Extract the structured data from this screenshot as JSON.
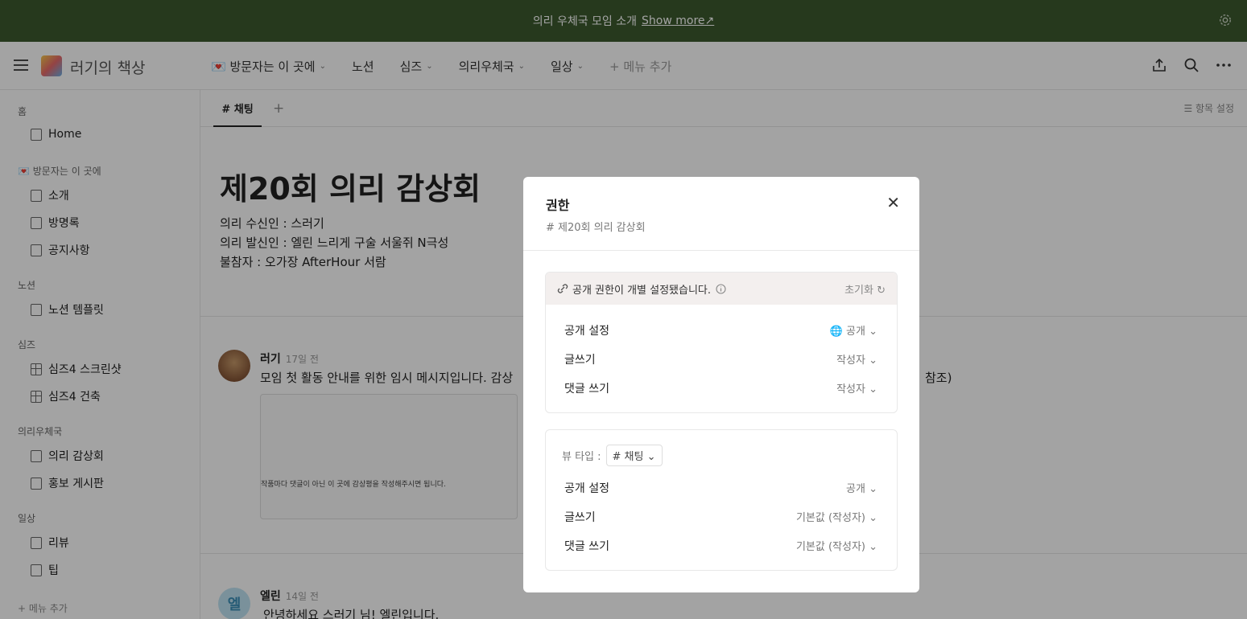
{
  "banner": {
    "text": "의리 우체국 모임 소개",
    "link": "Show more↗"
  },
  "header": {
    "site_title": "러기의 책상",
    "nav": [
      {
        "label": "💌 방문자는 이 곳에",
        "chev": "⌄"
      },
      {
        "label": "노션",
        "chev": ""
      },
      {
        "label": "심즈",
        "chev": "⌄"
      },
      {
        "label": "의리우체국",
        "chev": "⌄"
      },
      {
        "label": "일상",
        "chev": "⌄"
      }
    ],
    "add_menu": "+ 메뉴 추가"
  },
  "sidebar": {
    "sections": [
      {
        "title": "홈",
        "items": [
          "Home"
        ]
      },
      {
        "title": "💌 방문자는 이 곳에",
        "items": [
          "소개",
          "방명록",
          "공지사항"
        ]
      },
      {
        "title": "노션",
        "items": [
          "노션 템플릿"
        ]
      },
      {
        "title": "심즈",
        "items": [
          "심즈4 스크린샷",
          "심즈4 건축"
        ]
      },
      {
        "title": "의리우체국",
        "items": [
          "의리 감상회",
          "홍보 게시판"
        ]
      },
      {
        "title": "일상",
        "items": [
          "리뷰",
          "팁"
        ]
      }
    ],
    "add": "+ 메뉴 추가"
  },
  "tabs": {
    "active": "# 채팅",
    "plus": "+",
    "column_settings": "☰ 항목 설정"
  },
  "post": {
    "title": "제20회 의리 감상회",
    "lines": [
      "의리 수신인 : 스러기",
      "의리 발신인 : 엘린 느리게 구술 서울쥐 N극성",
      "불참자 : 오가장 AfterHour 서람"
    ]
  },
  "messages": [
    {
      "name": "러기",
      "time": "17일 전",
      "text": "모임 첫 활동 안내를 위한 임시 메시지입니다. 감상",
      "text_tail": "참조)",
      "card": "작품마다 댓글이 아닌 이 곳에 감상평을 작성해주시면 됩니다."
    },
    {
      "name": "엘린",
      "time": "14일 전",
      "text": "안녕하세요 스러기 님! 엘린입니다.",
      "avatar_letter": "엘"
    }
  ],
  "modal": {
    "title": "권한",
    "subtitle": "# 제20회 의리 감상회",
    "close": "✕",
    "notice": "공개 권한이 개별 설정됐습니다.",
    "reset": "초기화",
    "rows1": [
      {
        "label": "공개 설정",
        "value": "🌐 공개 ⌄"
      },
      {
        "label": "글쓰기",
        "value": "작성자 ⌄"
      },
      {
        "label": "댓글 쓰기",
        "value": "작성자 ⌄"
      }
    ],
    "view_type_label": "뷰 타입 :",
    "view_type_value": "# 채팅 ⌄",
    "rows2": [
      {
        "label": "공개 설정",
        "value": "공개 ⌄"
      },
      {
        "label": "글쓰기",
        "value": "기본값 (작성자) ⌄"
      },
      {
        "label": "댓글 쓰기",
        "value": "기본값 (작성자) ⌄"
      }
    ]
  },
  "colors": {
    "banner": "#3c5a2e",
    "overlay": "rgba(0,0,0,0.36)",
    "notice_bg": "#f3efee"
  }
}
